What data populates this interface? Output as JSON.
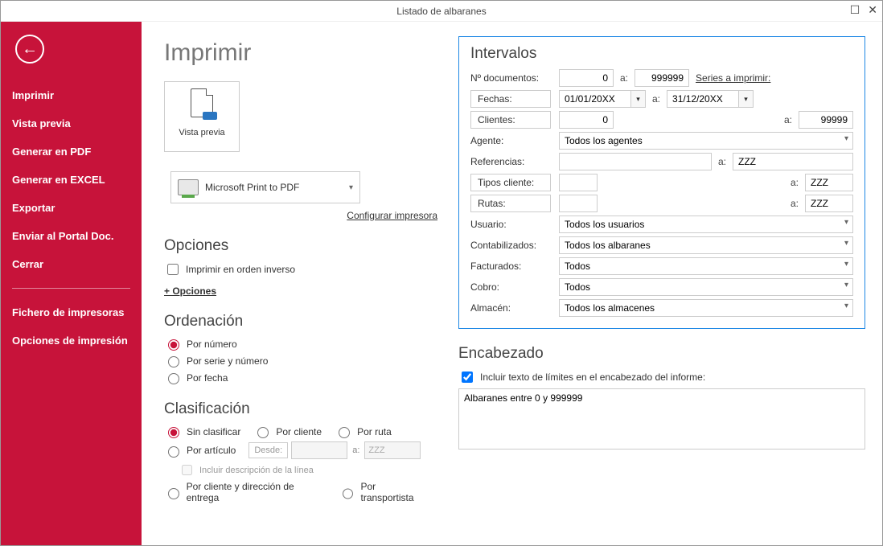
{
  "window": {
    "title": "Listado de albaranes"
  },
  "sidebar": {
    "items": [
      "Imprimir",
      "Vista previa",
      "Generar en PDF",
      "Generar en EXCEL",
      "Exportar",
      "Enviar al Portal Doc.",
      "Cerrar"
    ],
    "items2": [
      "Fichero de impresoras",
      "Opciones de impresión"
    ]
  },
  "main": {
    "title": "Imprimir",
    "preview_label": "Vista previa",
    "printer_name": "Microsoft Print to PDF",
    "configure_link": "Configurar impresora",
    "options_title": "Opciones",
    "reverse_print_label": "Imprimir en orden inverso",
    "more_options": "+ Opciones",
    "sort_title": "Ordenación",
    "sort": {
      "por_numero": "Por número",
      "por_serie": "Por serie y número",
      "por_fecha": "Por fecha"
    },
    "clasif_title": "Clasificación",
    "clasif": {
      "sin": "Sin clasificar",
      "cliente": "Por cliente",
      "ruta": "Por ruta",
      "articulo": "Por artículo",
      "desde": "Desde:",
      "a": "a:",
      "zzz": "ZZZ",
      "incl_desc": "Incluir descripción de la línea",
      "cliente_dir": "Por cliente y dirección de entrega",
      "transportista": "Por transportista"
    }
  },
  "intervalos": {
    "title": "Intervalos",
    "ndoc_label": "Nº documentos:",
    "ndoc_from": "0",
    "a": "a:",
    "ndoc_to": "999999",
    "series": "Series a imprimir:",
    "fechas_btn": "Fechas:",
    "fecha_from": "01/01/20XX",
    "fecha_to": "31/12/20XX",
    "clientes_btn": "Clientes:",
    "cli_from": "0",
    "cli_to": "99999",
    "agente_label": "Agente:",
    "agente_val": "Todos los agentes",
    "ref_label": "Referencias:",
    "ref_from": "",
    "ref_to": "ZZZ",
    "tipos_btn": "Tipos cliente:",
    "tipos_from": "",
    "tipos_to": "ZZZ",
    "rutas_btn": "Rutas:",
    "rutas_from": "",
    "rutas_to": "ZZZ",
    "usuario_label": "Usuario:",
    "usuario_val": "Todos los usuarios",
    "contab_label": "Contabilizados:",
    "contab_val": "Todos los albaranes",
    "fact_label": "Facturados:",
    "fact_val": "Todos",
    "cobro_label": "Cobro:",
    "cobro_val": "Todos",
    "almacen_label": "Almacén:",
    "almacen_val": "Todos los almacenes"
  },
  "encabezado": {
    "title": "Encabezado",
    "check_label": "Incluir texto de límites en el encabezado del informe:",
    "text": "Albaranes entre 0 y 999999"
  }
}
